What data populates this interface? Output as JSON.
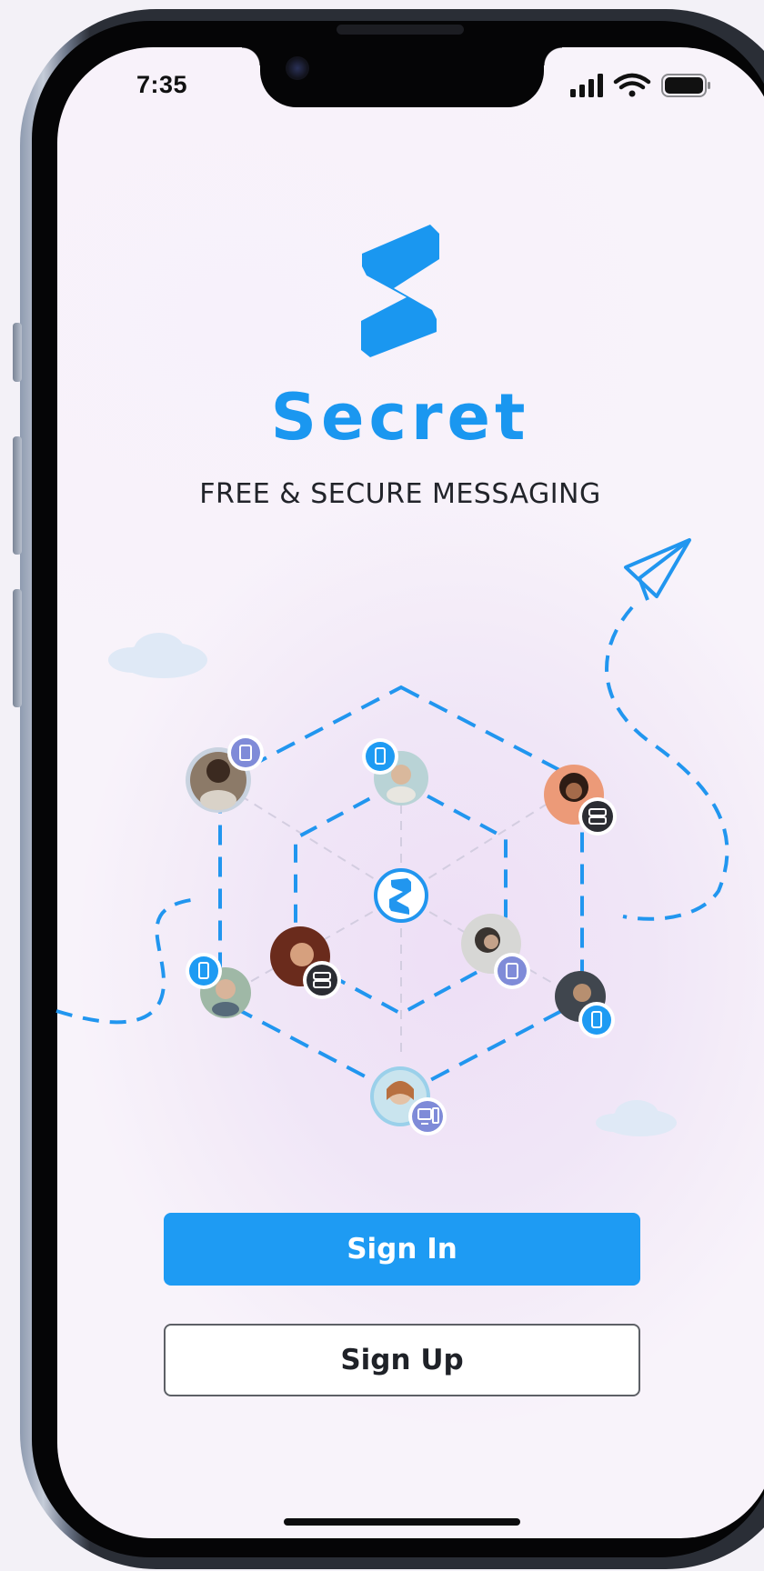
{
  "status_bar": {
    "time": "7:35",
    "icons": [
      "signal-icon",
      "wifi-icon",
      "battery-icon"
    ]
  },
  "app": {
    "name": "Secret",
    "tagline": "FREE & SECURE MESSAGING",
    "brand_color": "#1a97f0"
  },
  "illustration": {
    "center_icon": "logo-icon",
    "nodes": [
      {
        "name": "user-top-left",
        "badge": "tablet-icon"
      },
      {
        "name": "user-top-center",
        "badge": "phone-icon"
      },
      {
        "name": "user-top-right",
        "badge": "server-icon"
      },
      {
        "name": "user-inner-left",
        "badge": "server-icon"
      },
      {
        "name": "user-inner-right",
        "badge": "tablet-icon"
      },
      {
        "name": "user-bottom-left",
        "badge": "phone-icon"
      },
      {
        "name": "user-bottom-right",
        "badge": "phone-icon"
      },
      {
        "name": "user-bottom-center",
        "badge": "desktop-icon"
      }
    ],
    "decorations": [
      "paper-plane-icon",
      "cloud-icon",
      "cloud-icon"
    ]
  },
  "actions": {
    "sign_in": "Sign In",
    "sign_up": "Sign Up",
    "primary_color": "#1e9bf3"
  }
}
